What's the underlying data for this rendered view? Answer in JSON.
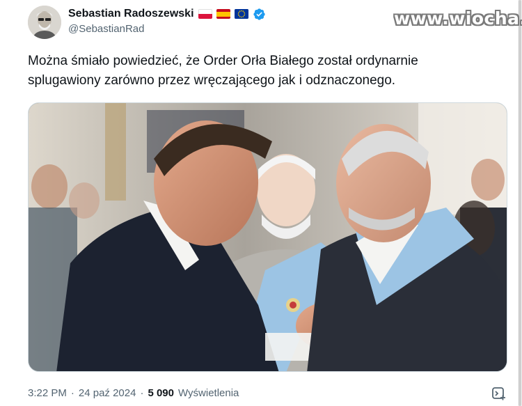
{
  "tweet": {
    "author": {
      "display_name": "Sebastian Radoszewski",
      "handle": "@SebastianRad",
      "flags": [
        "flag-poland-icon",
        "flag-spain-icon",
        "flag-eu-icon"
      ],
      "verified_icon": "verified-badge-icon",
      "verified_color": "#1d9bf0"
    },
    "text_lines": [
      "Można śmiało powiedzieć, że Order Orła Białego został ordynarnie",
      "splugawiony zarówno przez wręczającego jak i odznaczonego."
    ],
    "meta": {
      "time": "3:22 PM",
      "separator": "·",
      "date": "24 paź 2024",
      "views_count": "5 090",
      "views_label": "Wyświetlenia"
    }
  },
  "watermark": "www.wiocha.pl",
  "colors": {
    "text_primary": "#0f1419",
    "text_secondary": "#536471",
    "sash_blue": "#9cc4e4"
  }
}
